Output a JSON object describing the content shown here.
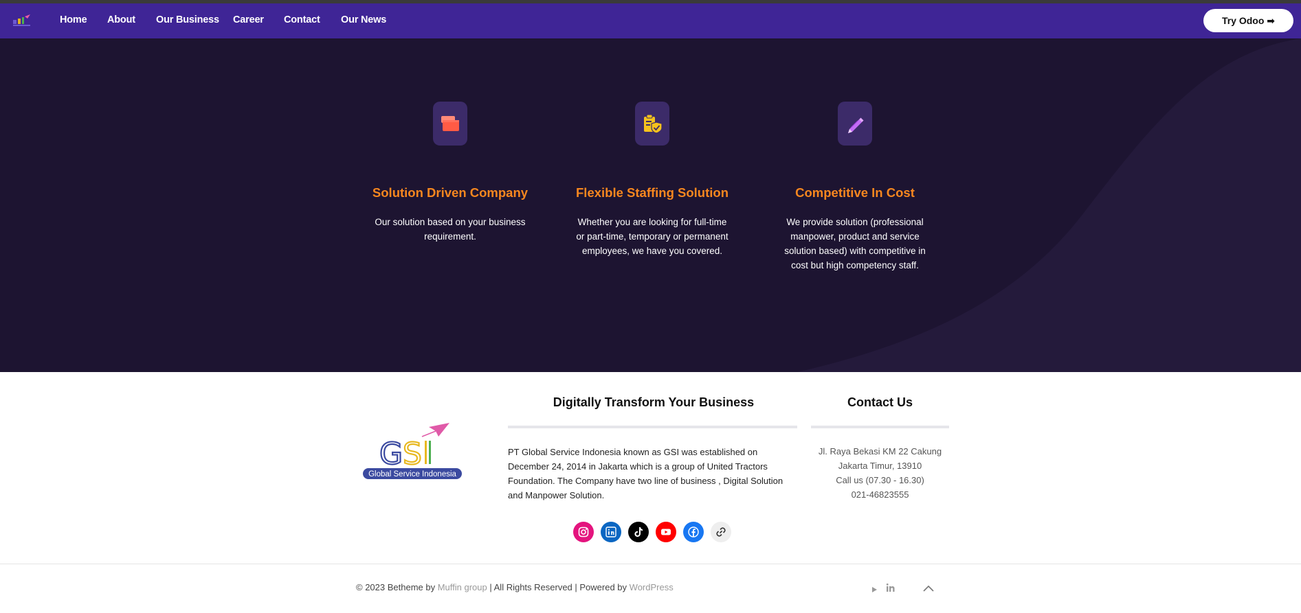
{
  "nav": {
    "items": [
      "Home",
      "About",
      "Our Business",
      "Career",
      "Contact",
      "Our News"
    ],
    "cta_label": "Try Odoo ➡"
  },
  "features": [
    {
      "icon": "folder-icon",
      "title": "Solution Driven Company",
      "description": "Our solution based on your business requirement."
    },
    {
      "icon": "clipboard-shield-icon",
      "title": "Flexible Staffing Solution",
      "description": "Whether you are looking for full-time or part-time, temporary or permanent employees, we have you covered."
    },
    {
      "icon": "pencil-icon",
      "title": "Competitive In Cost",
      "description": "We provide solution (professional manpower, product and service solution based) with competitive in cost but high competency staff."
    }
  ],
  "footer": {
    "logo_text": "Global Service Indonesia",
    "logo_letters": "GSI",
    "about_title": "Digitally Transform Your Business",
    "about_text": "PT Global Service Indonesia known as GSI was established on December 24, 2014  in Jakarta which is a group of United Tractors Foundation. The Company  have two line of business , Digital Solution and Manpower Solution.",
    "contact_title": "Contact Us",
    "contact_lines": [
      "Jl. Raya Bekasi KM 22 Cakung",
      "Jakarta Timur, 13910",
      "Call us (07.30 - 16.30)",
      "021-46823555"
    ],
    "social": [
      {
        "name": "instagram-icon",
        "color": "#e4147e"
      },
      {
        "name": "linkedin-icon",
        "color": "#0a66c2"
      },
      {
        "name": "tiktok-icon",
        "color": "#000000"
      },
      {
        "name": "youtube-icon",
        "color": "#ff0000"
      },
      {
        "name": "facebook-icon",
        "color": "#1877f2"
      },
      {
        "name": "link-icon",
        "color": "#eeeeee"
      }
    ],
    "copyright_prefix": "© 2023 Betheme by ",
    "copyright_link1": "Muffin group",
    "copyright_middle": " | All Rights Reserved | Powered by ",
    "copyright_link2": "WordPress"
  },
  "colors": {
    "nav_bg": "#3f2596",
    "hero_bg": "#1d1431",
    "accent_orange": "#f7871f"
  }
}
